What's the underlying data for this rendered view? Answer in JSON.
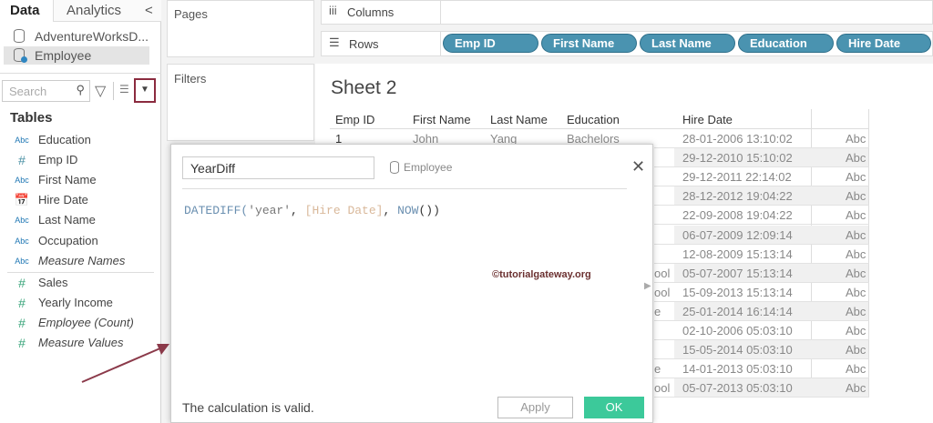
{
  "left_panel": {
    "tabs": [
      {
        "label": "Data"
      },
      {
        "label": "Analytics"
      }
    ],
    "collapse_glyph": "<",
    "sources": [
      {
        "label": "AdventureWorksD..."
      },
      {
        "label": "Employee"
      }
    ],
    "search_placeholder": "Search",
    "tables_label": "Tables",
    "dimensions": [
      {
        "type": "Abc",
        "name": "Education"
      },
      {
        "type": "#",
        "name": "Emp ID"
      },
      {
        "type": "Abc",
        "name": "First Name"
      },
      {
        "type": "date",
        "name": "Hire Date"
      },
      {
        "type": "Abc",
        "name": "Last Name"
      },
      {
        "type": "Abc",
        "name": "Occupation"
      },
      {
        "type": "Abc",
        "name": "Measure Names"
      }
    ],
    "measures": [
      {
        "name": "Sales"
      },
      {
        "name": "Yearly Income"
      },
      {
        "name": "Employee (Count)"
      },
      {
        "name": "Measure Values"
      }
    ]
  },
  "shelves": {
    "pages": "Pages",
    "filters": "Filters",
    "columns": "Columns",
    "rows": "Rows",
    "row_pills": [
      "Emp ID",
      "First Name",
      "Last Name",
      "Education",
      "Hire Date"
    ]
  },
  "sheet": {
    "title": "Sheet 2",
    "headers": [
      "Emp ID",
      "First Name",
      "Last Name",
      "Education",
      "Hire Date"
    ],
    "first_row": [
      "1",
      "John",
      "Yang",
      "Bachelors"
    ],
    "partial_education": [
      "",
      "",
      "",
      "",
      "",
      "",
      "ool",
      "ool",
      "e",
      "",
      "",
      "e",
      "ool"
    ],
    "hire_dates": [
      "28-01-2006 13:10:02",
      "29-12-2010 15:10:02",
      "29-12-2011 22:14:02",
      "28-12-2012 19:04:22",
      "22-09-2008 19:04:22",
      "06-07-2009 12:09:14",
      "12-08-2009 15:13:14",
      "05-07-2007 15:13:14",
      "15-09-2013 15:13:14",
      "25-01-2014 16:14:14",
      "02-10-2006 05:03:10",
      "15-05-2014 05:03:10",
      "14-01-2013 05:03:10",
      "05-07-2013 05:03:10"
    ],
    "abc_label": "Abc"
  },
  "dialog": {
    "name": "YearDiff",
    "datasource": "Employee",
    "formula": {
      "fn": "DATEDIFF(",
      "str": "'year'",
      "sep": ", ",
      "field": "[Hire Date]",
      "sep2": ", ",
      "now": "NOW",
      "end": "())"
    },
    "watermark": "©tutorialgateway.org",
    "status": "The calculation is valid.",
    "apply": "Apply",
    "ok": "OK"
  },
  "colors": {
    "pill": "#4a93b0",
    "ok": "#3cc99a",
    "highlight": "#8b2b3f"
  }
}
